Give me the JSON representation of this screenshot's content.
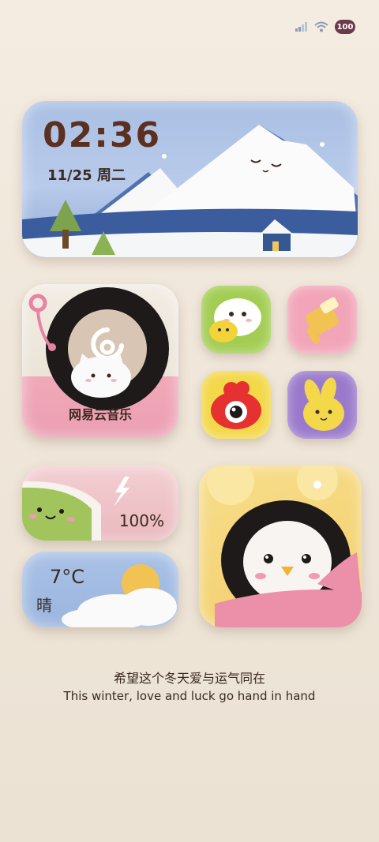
{
  "status_bar": {
    "battery_level": "100",
    "icons": [
      "signal-icon",
      "wifi-icon",
      "battery-icon"
    ]
  },
  "clock_widget": {
    "time": "02:36",
    "date": "11/25 周二"
  },
  "music_widget": {
    "label": "网易云音乐"
  },
  "apps": [
    {
      "icon": "wechat-icon"
    },
    {
      "icon": "paint-brush-icon"
    },
    {
      "icon": "weibo-icon"
    },
    {
      "icon": "bunny-icon"
    }
  ],
  "battery_widget": {
    "percent": "100%"
  },
  "weather_widget": {
    "temperature": "7°C",
    "condition": "晴"
  },
  "quote": {
    "chinese": "希望这个冬天爱与运气同在",
    "english": "This winter, love and luck go hand in hand"
  },
  "colors": {
    "background": "#efe6d9",
    "time_text": "#5b3020",
    "sky_blue": "#a9bfe2",
    "pink": "#eb9fb2"
  }
}
